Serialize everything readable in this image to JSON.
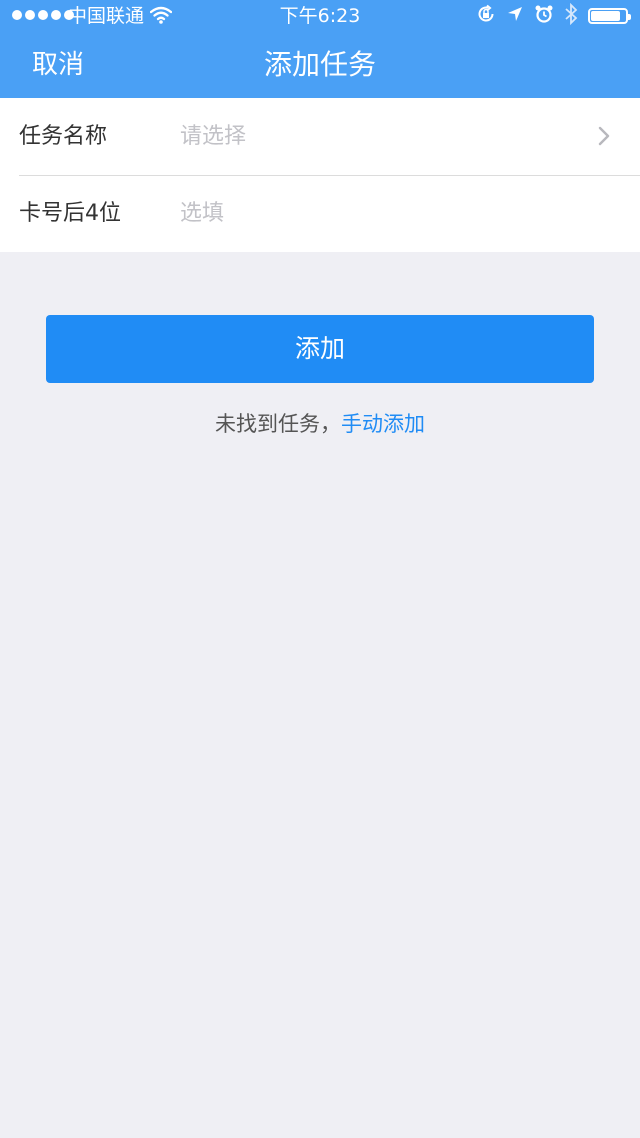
{
  "status_bar": {
    "carrier": "中国联通",
    "time": "下午6:23",
    "battery_level": 0.85,
    "signal_bars": 5
  },
  "nav": {
    "cancel_label": "取消",
    "title": "添加任务"
  },
  "form": {
    "task_name": {
      "label": "任务名称",
      "placeholder": "请选择"
    },
    "card_last4": {
      "label": "卡号后4位",
      "placeholder": "选填"
    }
  },
  "actions": {
    "add_label": "添加",
    "not_found_text": "未找到任务，",
    "manual_add_link": "手动添加"
  },
  "colors": {
    "header": "#4aa0f5",
    "button": "#208cf5",
    "background": "#efeff4",
    "link": "#208cf5"
  }
}
